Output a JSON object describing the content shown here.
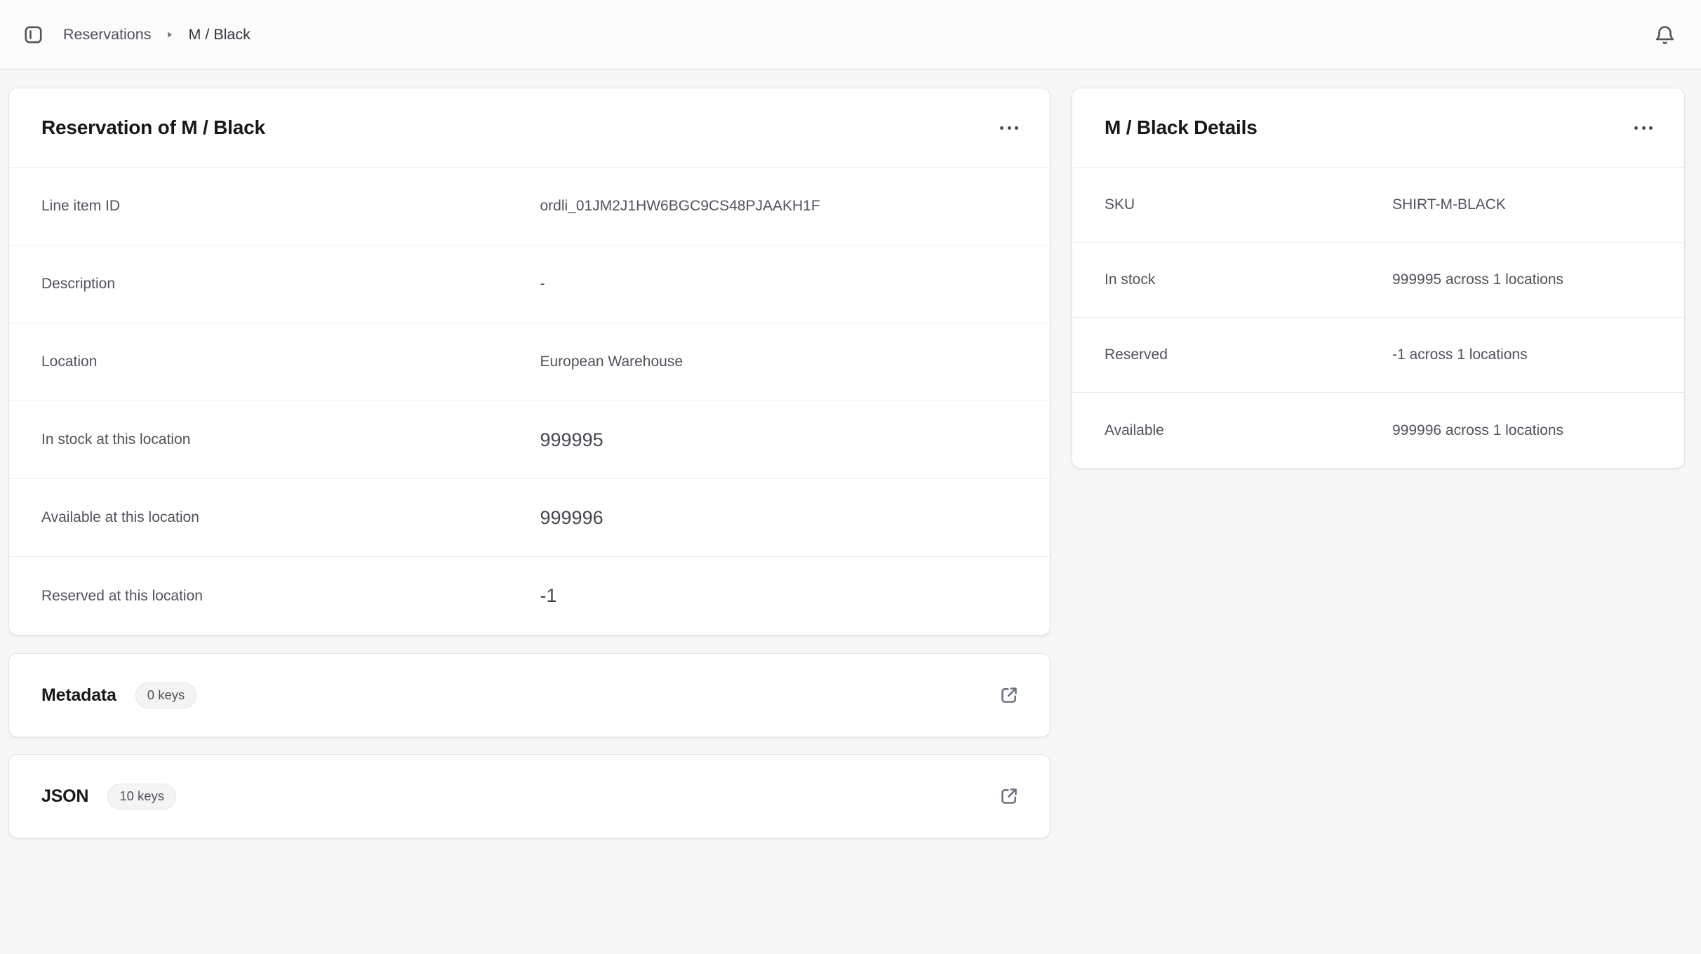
{
  "header": {
    "breadcrumb": {
      "root": "Reservations",
      "current": "M / Black"
    }
  },
  "reservation_card": {
    "title": "Reservation of M / Black",
    "rows": [
      {
        "label": "Line item ID",
        "value": "ordli_01JM2J1HW6BGC9CS48PJAAKH1F"
      },
      {
        "label": "Description",
        "value": "-"
      },
      {
        "label": "Location",
        "value": "European Warehouse"
      },
      {
        "label": "In stock at this location",
        "value": "999995"
      },
      {
        "label": "Available at this location",
        "value": "999996"
      },
      {
        "label": "Reserved at this location",
        "value": "-1"
      }
    ]
  },
  "metadata_card": {
    "title": "Metadata",
    "badge": "0 keys"
  },
  "json_card": {
    "title": "JSON",
    "badge": "10 keys"
  },
  "details_card": {
    "title": "M / Black Details",
    "rows": [
      {
        "label": "SKU",
        "value": "SHIRT-M-BLACK"
      },
      {
        "label": "In stock",
        "value": "999995 across 1 locations"
      },
      {
        "label": "Reserved",
        "value": "-1 across 1 locations"
      },
      {
        "label": "Available",
        "value": "999996 across 1 locations"
      }
    ]
  },
  "icons": {
    "sidebar_toggle": "panel-left-icon",
    "breadcrumb_separator": "chevron-right-icon",
    "notifications": "bell-icon",
    "card_menu": "ellipsis-icon",
    "open_external": "external-link-icon"
  },
  "colors": {
    "page_bg": "#f7f7f8",
    "topbar_bg": "#fbfbfb",
    "card_bg": "#ffffff",
    "card_border": "#e4e4e7",
    "divider": "#ededf0",
    "text_primary": "#18181b",
    "text_secondary": "#52525b"
  }
}
